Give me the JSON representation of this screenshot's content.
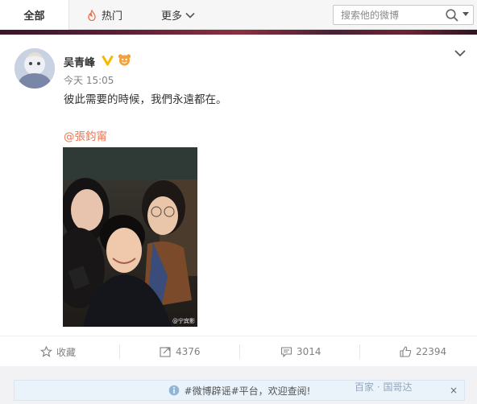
{
  "tabs": {
    "all_label": "全部",
    "hot_label": "热门",
    "more_label": "更多"
  },
  "search": {
    "placeholder": "搜索他的微博"
  },
  "post": {
    "author": "吴青峰",
    "time": "今天 15:05",
    "text": "彼此需要的時候，我們永遠都在。",
    "mention": "@張鈞甯",
    "photo_watermark": "@宁宾影"
  },
  "actions": {
    "favorite_label": "收藏",
    "repost_count": "4376",
    "comment_count": "3014",
    "like_count": "22394"
  },
  "notice": {
    "text": "#微博辟谣#平台，欢迎查阅!",
    "close_label": "×"
  },
  "overlay": {
    "text": "百家 · 国哥达"
  },
  "colors": {
    "accent_orange": "#eb7350",
    "verified_gold": "#f6b800",
    "notice_bg": "#eaf3fa"
  },
  "icons": [
    "fire-icon",
    "chevron-down-icon",
    "search-icon",
    "verified-icon",
    "member-icon",
    "star-icon",
    "repost-icon",
    "comment-icon",
    "like-icon",
    "info-icon",
    "close-icon"
  ]
}
